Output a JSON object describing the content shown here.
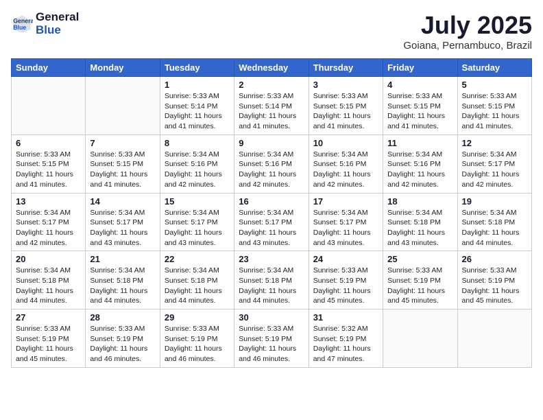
{
  "header": {
    "logo_general": "General",
    "logo_blue": "Blue",
    "title": "July 2025",
    "subtitle": "Goiana, Pernambuco, Brazil"
  },
  "days_of_week": [
    "Sunday",
    "Monday",
    "Tuesday",
    "Wednesday",
    "Thursday",
    "Friday",
    "Saturday"
  ],
  "weeks": [
    [
      {
        "day": "",
        "text": ""
      },
      {
        "day": "",
        "text": ""
      },
      {
        "day": "1",
        "text": "Sunrise: 5:33 AM\nSunset: 5:14 PM\nDaylight: 11 hours\nand 41 minutes."
      },
      {
        "day": "2",
        "text": "Sunrise: 5:33 AM\nSunset: 5:14 PM\nDaylight: 11 hours\nand 41 minutes."
      },
      {
        "day": "3",
        "text": "Sunrise: 5:33 AM\nSunset: 5:15 PM\nDaylight: 11 hours\nand 41 minutes."
      },
      {
        "day": "4",
        "text": "Sunrise: 5:33 AM\nSunset: 5:15 PM\nDaylight: 11 hours\nand 41 minutes."
      },
      {
        "day": "5",
        "text": "Sunrise: 5:33 AM\nSunset: 5:15 PM\nDaylight: 11 hours\nand 41 minutes."
      }
    ],
    [
      {
        "day": "6",
        "text": "Sunrise: 5:33 AM\nSunset: 5:15 PM\nDaylight: 11 hours\nand 41 minutes."
      },
      {
        "day": "7",
        "text": "Sunrise: 5:33 AM\nSunset: 5:15 PM\nDaylight: 11 hours\nand 41 minutes."
      },
      {
        "day": "8",
        "text": "Sunrise: 5:34 AM\nSunset: 5:16 PM\nDaylight: 11 hours\nand 42 minutes."
      },
      {
        "day": "9",
        "text": "Sunrise: 5:34 AM\nSunset: 5:16 PM\nDaylight: 11 hours\nand 42 minutes."
      },
      {
        "day": "10",
        "text": "Sunrise: 5:34 AM\nSunset: 5:16 PM\nDaylight: 11 hours\nand 42 minutes."
      },
      {
        "day": "11",
        "text": "Sunrise: 5:34 AM\nSunset: 5:16 PM\nDaylight: 11 hours\nand 42 minutes."
      },
      {
        "day": "12",
        "text": "Sunrise: 5:34 AM\nSunset: 5:17 PM\nDaylight: 11 hours\nand 42 minutes."
      }
    ],
    [
      {
        "day": "13",
        "text": "Sunrise: 5:34 AM\nSunset: 5:17 PM\nDaylight: 11 hours\nand 42 minutes."
      },
      {
        "day": "14",
        "text": "Sunrise: 5:34 AM\nSunset: 5:17 PM\nDaylight: 11 hours\nand 43 minutes."
      },
      {
        "day": "15",
        "text": "Sunrise: 5:34 AM\nSunset: 5:17 PM\nDaylight: 11 hours\nand 43 minutes."
      },
      {
        "day": "16",
        "text": "Sunrise: 5:34 AM\nSunset: 5:17 PM\nDaylight: 11 hours\nand 43 minutes."
      },
      {
        "day": "17",
        "text": "Sunrise: 5:34 AM\nSunset: 5:17 PM\nDaylight: 11 hours\nand 43 minutes."
      },
      {
        "day": "18",
        "text": "Sunrise: 5:34 AM\nSunset: 5:18 PM\nDaylight: 11 hours\nand 43 minutes."
      },
      {
        "day": "19",
        "text": "Sunrise: 5:34 AM\nSunset: 5:18 PM\nDaylight: 11 hours\nand 44 minutes."
      }
    ],
    [
      {
        "day": "20",
        "text": "Sunrise: 5:34 AM\nSunset: 5:18 PM\nDaylight: 11 hours\nand 44 minutes."
      },
      {
        "day": "21",
        "text": "Sunrise: 5:34 AM\nSunset: 5:18 PM\nDaylight: 11 hours\nand 44 minutes."
      },
      {
        "day": "22",
        "text": "Sunrise: 5:34 AM\nSunset: 5:18 PM\nDaylight: 11 hours\nand 44 minutes."
      },
      {
        "day": "23",
        "text": "Sunrise: 5:34 AM\nSunset: 5:18 PM\nDaylight: 11 hours\nand 44 minutes."
      },
      {
        "day": "24",
        "text": "Sunrise: 5:33 AM\nSunset: 5:19 PM\nDaylight: 11 hours\nand 45 minutes."
      },
      {
        "day": "25",
        "text": "Sunrise: 5:33 AM\nSunset: 5:19 PM\nDaylight: 11 hours\nand 45 minutes."
      },
      {
        "day": "26",
        "text": "Sunrise: 5:33 AM\nSunset: 5:19 PM\nDaylight: 11 hours\nand 45 minutes."
      }
    ],
    [
      {
        "day": "27",
        "text": "Sunrise: 5:33 AM\nSunset: 5:19 PM\nDaylight: 11 hours\nand 45 minutes."
      },
      {
        "day": "28",
        "text": "Sunrise: 5:33 AM\nSunset: 5:19 PM\nDaylight: 11 hours\nand 46 minutes."
      },
      {
        "day": "29",
        "text": "Sunrise: 5:33 AM\nSunset: 5:19 PM\nDaylight: 11 hours\nand 46 minutes."
      },
      {
        "day": "30",
        "text": "Sunrise: 5:33 AM\nSunset: 5:19 PM\nDaylight: 11 hours\nand 46 minutes."
      },
      {
        "day": "31",
        "text": "Sunrise: 5:32 AM\nSunset: 5:19 PM\nDaylight: 11 hours\nand 47 minutes."
      },
      {
        "day": "",
        "text": ""
      },
      {
        "day": "",
        "text": ""
      }
    ]
  ]
}
